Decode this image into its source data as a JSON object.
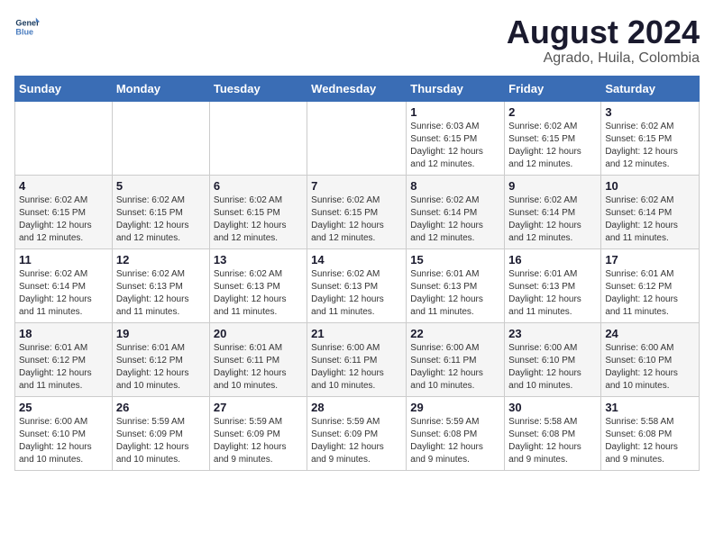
{
  "header": {
    "logo_line1": "General",
    "logo_line2": "Blue",
    "title": "August 2024",
    "subtitle": "Agrado, Huila, Colombia"
  },
  "weekdays": [
    "Sunday",
    "Monday",
    "Tuesday",
    "Wednesday",
    "Thursday",
    "Friday",
    "Saturday"
  ],
  "weeks": [
    [
      {
        "day": "",
        "info": ""
      },
      {
        "day": "",
        "info": ""
      },
      {
        "day": "",
        "info": ""
      },
      {
        "day": "",
        "info": ""
      },
      {
        "day": "1",
        "info": "Sunrise: 6:03 AM\nSunset: 6:15 PM\nDaylight: 12 hours\nand 12 minutes."
      },
      {
        "day": "2",
        "info": "Sunrise: 6:02 AM\nSunset: 6:15 PM\nDaylight: 12 hours\nand 12 minutes."
      },
      {
        "day": "3",
        "info": "Sunrise: 6:02 AM\nSunset: 6:15 PM\nDaylight: 12 hours\nand 12 minutes."
      }
    ],
    [
      {
        "day": "4",
        "info": "Sunrise: 6:02 AM\nSunset: 6:15 PM\nDaylight: 12 hours\nand 12 minutes."
      },
      {
        "day": "5",
        "info": "Sunrise: 6:02 AM\nSunset: 6:15 PM\nDaylight: 12 hours\nand 12 minutes."
      },
      {
        "day": "6",
        "info": "Sunrise: 6:02 AM\nSunset: 6:15 PM\nDaylight: 12 hours\nand 12 minutes."
      },
      {
        "day": "7",
        "info": "Sunrise: 6:02 AM\nSunset: 6:15 PM\nDaylight: 12 hours\nand 12 minutes."
      },
      {
        "day": "8",
        "info": "Sunrise: 6:02 AM\nSunset: 6:14 PM\nDaylight: 12 hours\nand 12 minutes."
      },
      {
        "day": "9",
        "info": "Sunrise: 6:02 AM\nSunset: 6:14 PM\nDaylight: 12 hours\nand 12 minutes."
      },
      {
        "day": "10",
        "info": "Sunrise: 6:02 AM\nSunset: 6:14 PM\nDaylight: 12 hours\nand 11 minutes."
      }
    ],
    [
      {
        "day": "11",
        "info": "Sunrise: 6:02 AM\nSunset: 6:14 PM\nDaylight: 12 hours\nand 11 minutes."
      },
      {
        "day": "12",
        "info": "Sunrise: 6:02 AM\nSunset: 6:13 PM\nDaylight: 12 hours\nand 11 minutes."
      },
      {
        "day": "13",
        "info": "Sunrise: 6:02 AM\nSunset: 6:13 PM\nDaylight: 12 hours\nand 11 minutes."
      },
      {
        "day": "14",
        "info": "Sunrise: 6:02 AM\nSunset: 6:13 PM\nDaylight: 12 hours\nand 11 minutes."
      },
      {
        "day": "15",
        "info": "Sunrise: 6:01 AM\nSunset: 6:13 PM\nDaylight: 12 hours\nand 11 minutes."
      },
      {
        "day": "16",
        "info": "Sunrise: 6:01 AM\nSunset: 6:13 PM\nDaylight: 12 hours\nand 11 minutes."
      },
      {
        "day": "17",
        "info": "Sunrise: 6:01 AM\nSunset: 6:12 PM\nDaylight: 12 hours\nand 11 minutes."
      }
    ],
    [
      {
        "day": "18",
        "info": "Sunrise: 6:01 AM\nSunset: 6:12 PM\nDaylight: 12 hours\nand 11 minutes."
      },
      {
        "day": "19",
        "info": "Sunrise: 6:01 AM\nSunset: 6:12 PM\nDaylight: 12 hours\nand 10 minutes."
      },
      {
        "day": "20",
        "info": "Sunrise: 6:01 AM\nSunset: 6:11 PM\nDaylight: 12 hours\nand 10 minutes."
      },
      {
        "day": "21",
        "info": "Sunrise: 6:00 AM\nSunset: 6:11 PM\nDaylight: 12 hours\nand 10 minutes."
      },
      {
        "day": "22",
        "info": "Sunrise: 6:00 AM\nSunset: 6:11 PM\nDaylight: 12 hours\nand 10 minutes."
      },
      {
        "day": "23",
        "info": "Sunrise: 6:00 AM\nSunset: 6:10 PM\nDaylight: 12 hours\nand 10 minutes."
      },
      {
        "day": "24",
        "info": "Sunrise: 6:00 AM\nSunset: 6:10 PM\nDaylight: 12 hours\nand 10 minutes."
      }
    ],
    [
      {
        "day": "25",
        "info": "Sunrise: 6:00 AM\nSunset: 6:10 PM\nDaylight: 12 hours\nand 10 minutes."
      },
      {
        "day": "26",
        "info": "Sunrise: 5:59 AM\nSunset: 6:09 PM\nDaylight: 12 hours\nand 10 minutes."
      },
      {
        "day": "27",
        "info": "Sunrise: 5:59 AM\nSunset: 6:09 PM\nDaylight: 12 hours\nand 9 minutes."
      },
      {
        "day": "28",
        "info": "Sunrise: 5:59 AM\nSunset: 6:09 PM\nDaylight: 12 hours\nand 9 minutes."
      },
      {
        "day": "29",
        "info": "Sunrise: 5:59 AM\nSunset: 6:08 PM\nDaylight: 12 hours\nand 9 minutes."
      },
      {
        "day": "30",
        "info": "Sunrise: 5:58 AM\nSunset: 6:08 PM\nDaylight: 12 hours\nand 9 minutes."
      },
      {
        "day": "31",
        "info": "Sunrise: 5:58 AM\nSunset: 6:08 PM\nDaylight: 12 hours\nand 9 minutes."
      }
    ]
  ]
}
